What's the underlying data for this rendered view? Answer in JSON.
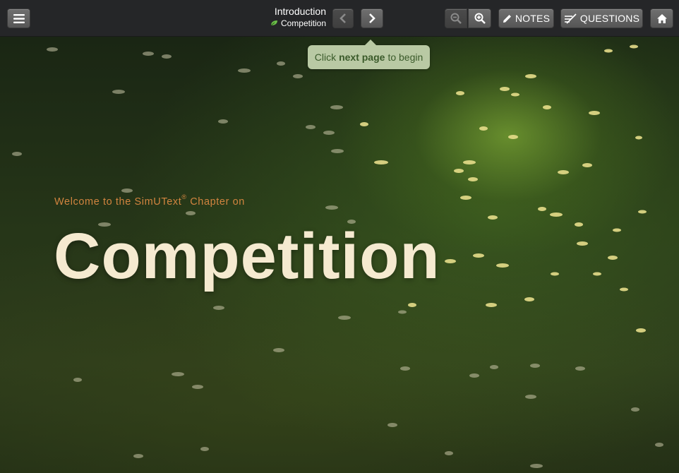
{
  "header": {
    "menu_icon": "hamburger-icon",
    "section_title": "Introduction",
    "chapter_name": "Competition",
    "chapter_icon": "leaf-icon",
    "prev_icon": "chevron-left-icon",
    "next_icon": "chevron-right-icon",
    "zoom_out_icon": "zoom-out-icon",
    "zoom_in_icon": "zoom-in-icon",
    "notes_label": "NOTES",
    "notes_icon": "pencil-icon",
    "questions_label": "QUESTIONS",
    "questions_icon": "questions-icon",
    "home_icon": "home-icon"
  },
  "tooltip": {
    "prefix": "Click",
    "emphasis": "next page",
    "suffix": "to begin"
  },
  "hero": {
    "welcome_text": "Welcome to the SimUText",
    "registered_mark": "®",
    "welcome_suffix": "Chapter on",
    "title": "Competition"
  },
  "colors": {
    "accent_orange": "#d1843f",
    "title_cream": "#f5ead0",
    "tooltip_bg": "#b9c9a4",
    "leaf_green": "#6cc04a"
  }
}
